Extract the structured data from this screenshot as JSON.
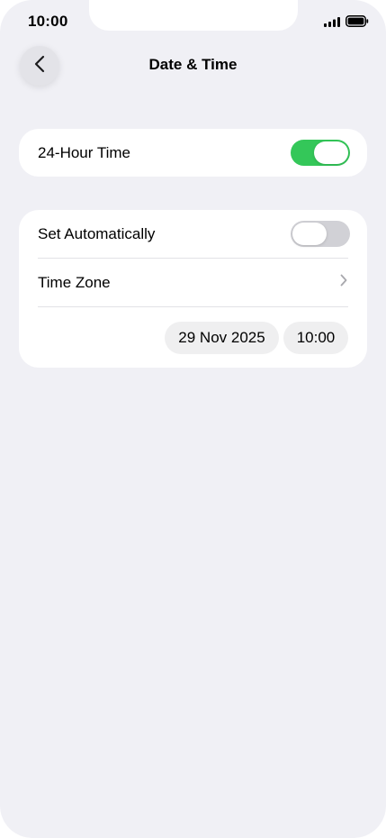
{
  "status_bar": {
    "time": "10:00",
    "icons": [
      "signal-icon",
      "battery-icon"
    ]
  },
  "header": {
    "back_icon": "chevron-left-icon",
    "title": "Date & Time"
  },
  "settings": {
    "hour24": {
      "label": "24-Hour Time",
      "enabled": true
    },
    "set_automatically": {
      "label": "Set Automatically",
      "enabled": false
    },
    "time_zone": {
      "label": "Time Zone",
      "icon": "chevron-right-icon"
    },
    "date": "29 Nov 2025",
    "time": "10:00"
  },
  "colors": {
    "background": "#f0f0f5",
    "toggle_on": "#34c759",
    "toggle_off": "#d1d1d6"
  }
}
